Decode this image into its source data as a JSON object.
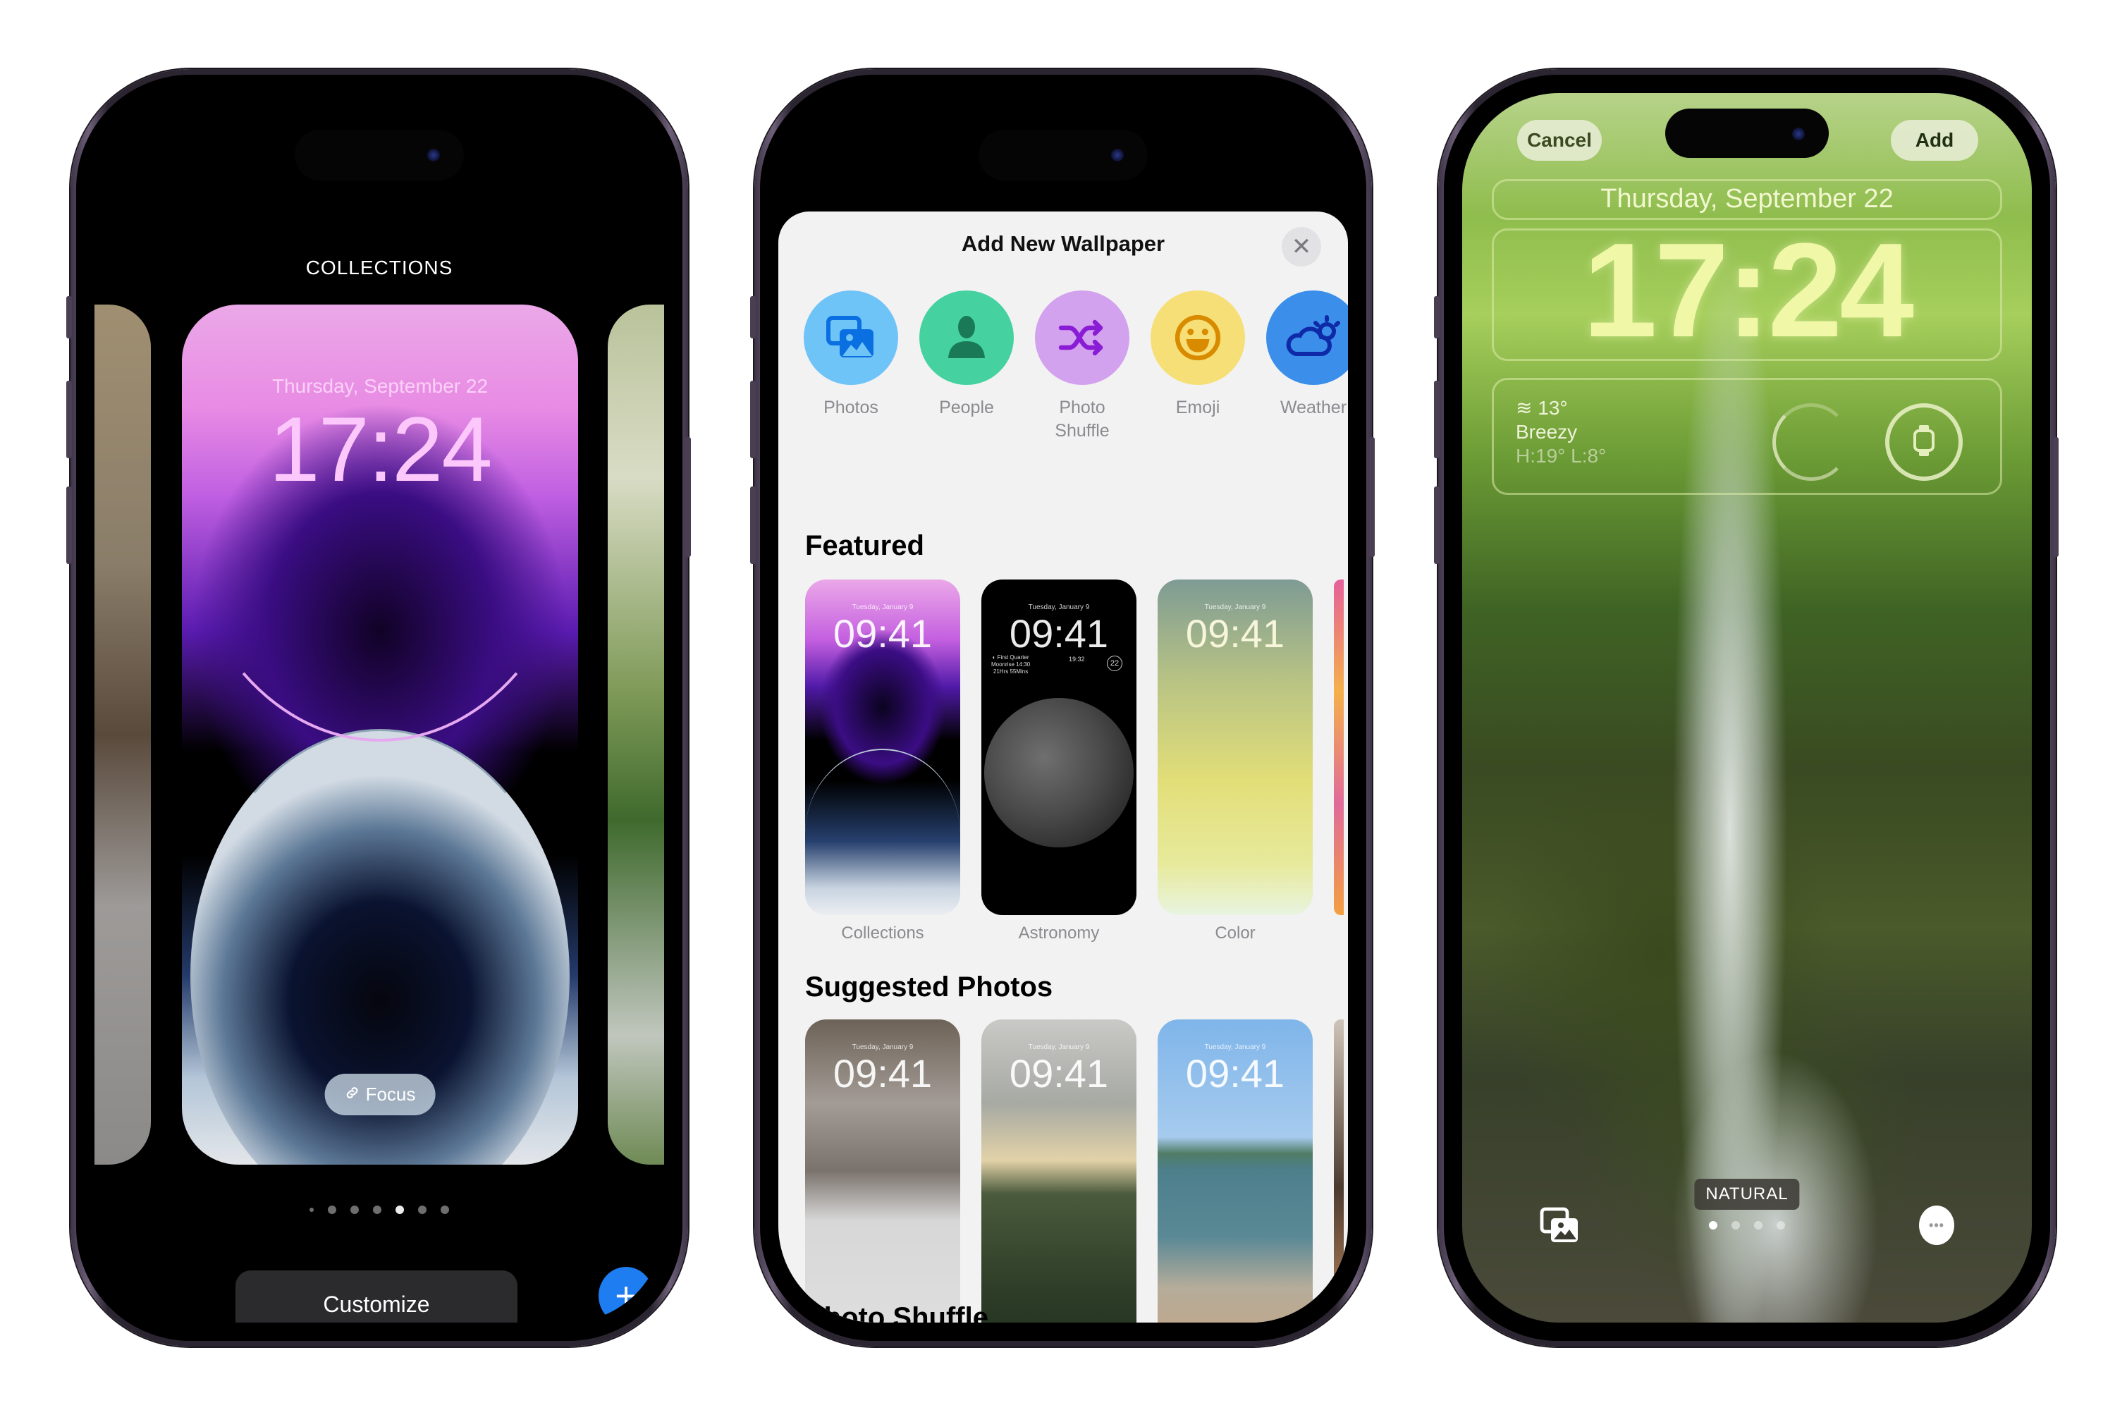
{
  "phone1": {
    "title": "COLLECTIONS",
    "wallpaper": {
      "date": "Thursday, September 22",
      "time": "17:24",
      "focus_label": "Focus",
      "focus_icon": "link-icon"
    },
    "page_dots": {
      "count": 7,
      "active_index": 4
    },
    "customize_label": "Customize",
    "add_icon": "plus-icon",
    "add_symbol": "+"
  },
  "phone2": {
    "sheet_title": "Add New Wallpaper",
    "close_symbol": "✕",
    "categories": [
      {
        "label": "Photos",
        "icon": "photos-icon",
        "bg": "#6ec3f7",
        "fg": "#0a6fe0"
      },
      {
        "label": "People",
        "icon": "person-icon",
        "bg": "#45d2a0",
        "fg": "#1a7a58"
      },
      {
        "label": "Photo Shuffle",
        "icon": "shuffle-icon",
        "bg": "#d3a2ee",
        "fg": "#8a1cd6"
      },
      {
        "label": "Emoji",
        "icon": "smiley-icon",
        "bg": "#f6df76",
        "fg": "#d98b00"
      },
      {
        "label": "Weather",
        "icon": "weather-cloud-sun-icon",
        "bg": "#3b8fea",
        "fg": "#0f2aa8"
      }
    ],
    "featured": {
      "heading": "Featured",
      "items": [
        {
          "label": "Collections",
          "date": "Tuesday, January 9",
          "time": "09:41"
        },
        {
          "label": "Astronomy",
          "date": "Tuesday, January 9",
          "time": "09:41",
          "widget_lines": [
            "◐ First Quarter",
            "Moonrise 14:30",
            "21Hrs 55Mins"
          ],
          "widget_sun": "19:32",
          "widget_ring": "22"
        },
        {
          "label": "Color",
          "date": "Tuesday, January 9",
          "time": "09:41"
        }
      ]
    },
    "suggested": {
      "heading": "Suggested Photos",
      "items": [
        {
          "date": "Tuesday, January 9",
          "time": "09:41"
        },
        {
          "date": "Tuesday, January 9",
          "time": "09:41"
        },
        {
          "date": "Tuesday, January 9",
          "time": "09:41"
        }
      ]
    },
    "next_heading": "Photo Shuffle"
  },
  "phone3": {
    "cancel_label": "Cancel",
    "add_label": "Add",
    "date": "Thursday, September 22",
    "time": "17:24",
    "weather": {
      "temp": "13°",
      "condition": "Breezy",
      "hilo": "H:19° L:8°"
    },
    "style_label": "NATURAL",
    "page_dots": {
      "count": 4,
      "active_index": 0
    },
    "gallery_icon": "photo-library-icon",
    "more_icon": "ellipsis-icon",
    "more_symbol": "•••"
  }
}
